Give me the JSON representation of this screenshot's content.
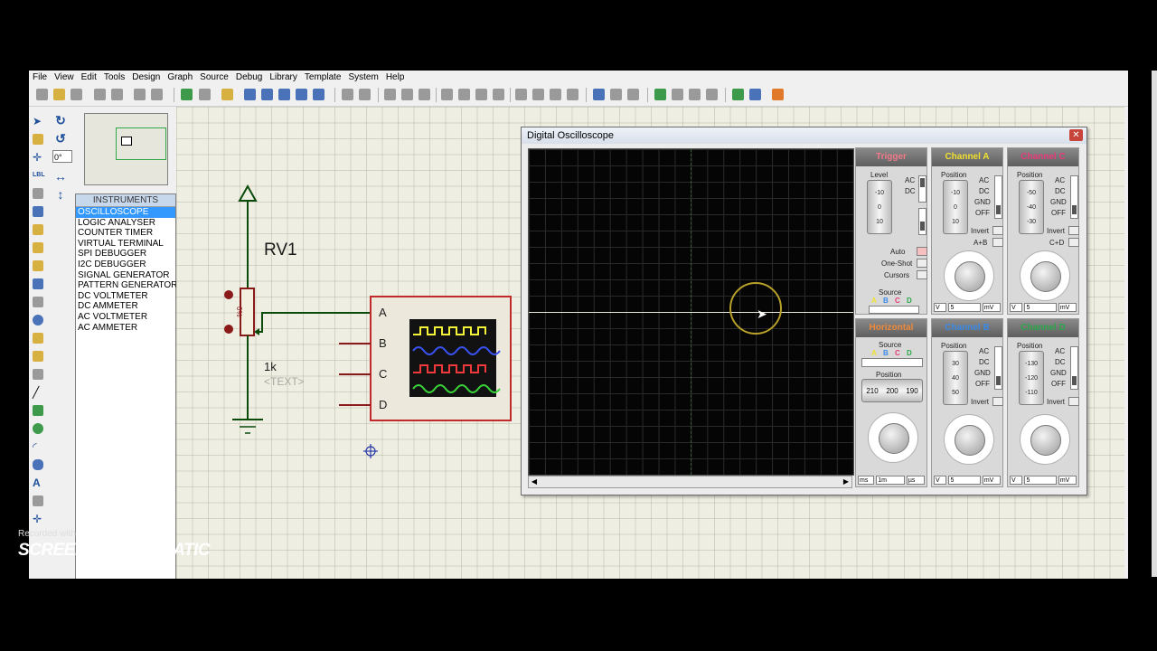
{
  "menubar": [
    "File",
    "View",
    "Edit",
    "Tools",
    "Design",
    "Graph",
    "Source",
    "Debug",
    "Library",
    "Template",
    "System",
    "Help"
  ],
  "side": {
    "angle": "0°"
  },
  "devices": {
    "header": "INSTRUMENTS",
    "items": [
      "OSCILLOSCOPE",
      "LOGIC ANALYSER",
      "COUNTER TIMER",
      "VIRTUAL TERMINAL",
      "SPI DEBUGGER",
      "I2C DEBUGGER",
      "SIGNAL GENERATOR",
      "PATTERN GENERATOR",
      "DC VOLTMETER",
      "DC AMMETER",
      "AC VOLTMETER",
      "AC AMMETER"
    ],
    "selected": 0
  },
  "schematic": {
    "ref": "RV1",
    "percent": "0%",
    "value": "1k",
    "text": "<TEXT>",
    "pins": [
      "A",
      "B",
      "C",
      "D"
    ],
    "trace_colors": [
      "#f2f23a",
      "#3a52f2",
      "#f23a3a",
      "#3ad23a"
    ]
  },
  "osc": {
    "title": "Digital Oscilloscope",
    "trigger": {
      "title": "Trigger",
      "level": "Level",
      "vals": [
        "-10",
        "0",
        "10"
      ],
      "ac": "AC",
      "dc": "DC",
      "auto": "Auto",
      "oneshot": "One-Shot",
      "cursors": "Cursors",
      "source": "Source",
      "src": [
        "A",
        "B",
        "C",
        "D"
      ]
    },
    "horizontal": {
      "title": "Horizontal",
      "source": "Source",
      "src": [
        "A",
        "B",
        "C",
        "D"
      ],
      "position": "Position",
      "pos_vals": [
        "210",
        "200",
        "190"
      ],
      "units": [
        "ms",
        "1m",
        "µs"
      ]
    },
    "chA": {
      "title": "Channel A",
      "color": "#f0e030",
      "position": "Position",
      "vals": [
        "-10",
        "0",
        "10"
      ],
      "opts": [
        "AC",
        "DC",
        "GND",
        "OFF"
      ],
      "invert": "Invert",
      "combo": "A+B",
      "units": [
        "V",
        "5",
        "mV"
      ]
    },
    "chB": {
      "title": "Channel B",
      "color": "#3a8ae8",
      "position": "Position",
      "vals": [
        "30",
        "40",
        "50"
      ],
      "opts": [
        "AC",
        "DC",
        "GND",
        "OFF"
      ],
      "invert": "Invert",
      "units": [
        "V",
        "5",
        "mV"
      ]
    },
    "chC": {
      "title": "Channel C",
      "color": "#e83a7a",
      "position": "Position",
      "vals": [
        "-50",
        "-40",
        "-30"
      ],
      "opts": [
        "AC",
        "DC",
        "GND",
        "OFF"
      ],
      "invert": "Invert",
      "combo": "C+D",
      "units": [
        "V",
        "5",
        "mV"
      ]
    },
    "chD": {
      "title": "Channel D",
      "color": "#2aa84a",
      "position": "Position",
      "vals": [
        "-130",
        "-120",
        "-110"
      ],
      "opts": [
        "AC",
        "DC",
        "GND",
        "OFF"
      ],
      "invert": "Invert",
      "units": [
        "V",
        "5",
        "mV"
      ]
    }
  },
  "watermark": {
    "recorded": "Recorded with",
    "brand1": "SCREENCAST",
    "brand2": "MATIC"
  }
}
